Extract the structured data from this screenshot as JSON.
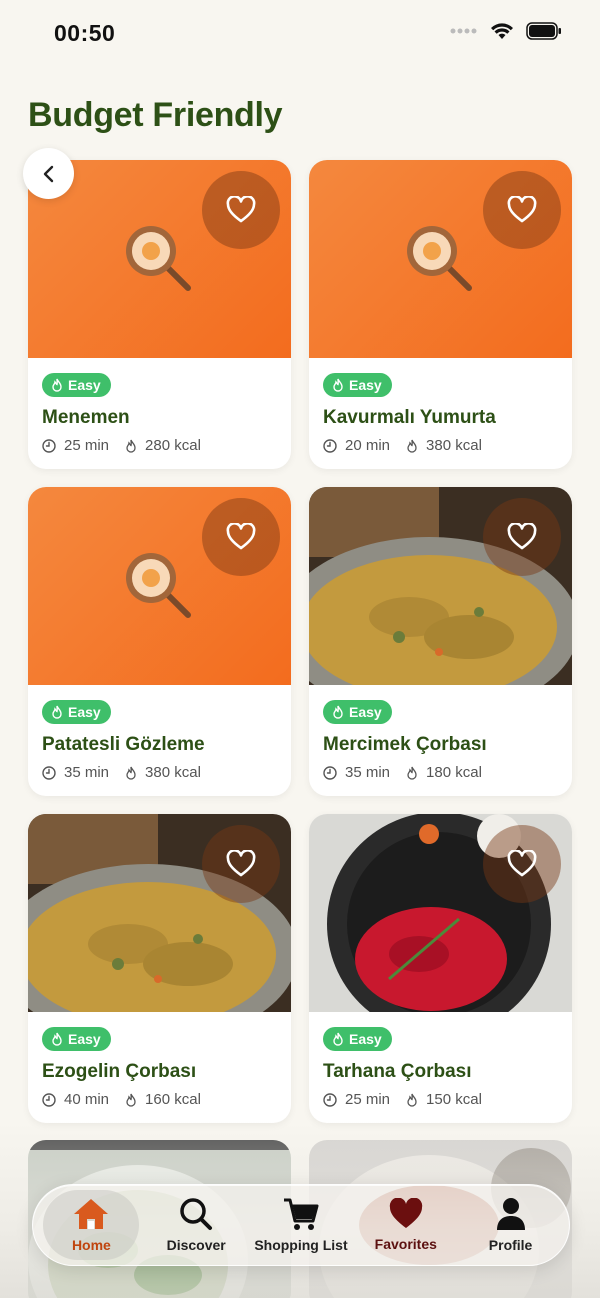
{
  "status": {
    "time": "00:50"
  },
  "page": {
    "title": "Budget Friendly"
  },
  "recipes": [
    {
      "name": "Menemen",
      "difficulty": "Easy",
      "time": "25 min",
      "calories": "280 kcal",
      "image": "placeholder"
    },
    {
      "name": "Kavurmalı Yumurta",
      "difficulty": "Easy",
      "time": "20 min",
      "calories": "380 kcal",
      "image": "placeholder"
    },
    {
      "name": "Patatesli Gözleme",
      "difficulty": "Easy",
      "time": "35 min",
      "calories": "380 kcal",
      "image": "placeholder"
    },
    {
      "name": "Mercimek Çorbası",
      "difficulty": "Easy",
      "time": "35 min",
      "calories": "180 kcal",
      "image": "lentil-soup"
    },
    {
      "name": "Ezogelin Çorbası",
      "difficulty": "Easy",
      "time": "40 min",
      "calories": "160 kcal",
      "image": "lentil-soup"
    },
    {
      "name": "Tarhana Çorbası",
      "difficulty": "Easy",
      "time": "25 min",
      "calories": "150 kcal",
      "image": "red-soup"
    }
  ],
  "tabs": [
    {
      "label": "Home",
      "icon": "home-icon",
      "active": true
    },
    {
      "label": "Discover",
      "icon": "search-icon",
      "active": false
    },
    {
      "label": "Shopping List",
      "icon": "cart-icon",
      "active": false
    },
    {
      "label": "Favorites",
      "icon": "heart-icon",
      "active": false
    },
    {
      "label": "Profile",
      "icon": "person-icon",
      "active": false
    }
  ],
  "colors": {
    "accent": "#2d5016",
    "badge": "#3fbf6a",
    "placeholder": "#f36c1e",
    "active_tab": "#c0450e"
  }
}
